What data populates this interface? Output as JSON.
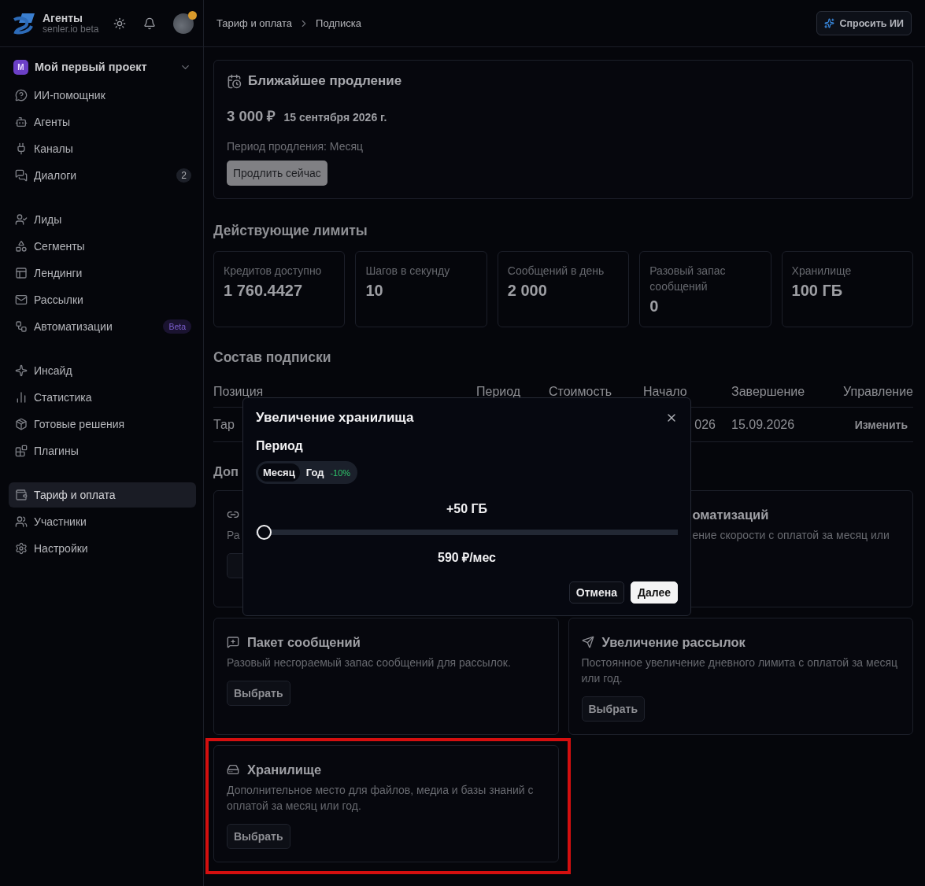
{
  "sidebar": {
    "brand": {
      "name": "Агенты",
      "subtitle": "senler.io beta"
    },
    "project": {
      "initial": "М",
      "name": "Мой первый проект"
    },
    "groups": [
      {
        "items": [
          {
            "label": "ИИ-помощник",
            "selected": false
          },
          {
            "label": "Агенты",
            "selected": false
          },
          {
            "label": "Каналы",
            "selected": false
          },
          {
            "label": "Диалоги",
            "selected": false,
            "badge": {
              "text": "2",
              "kind": "count"
            }
          }
        ]
      },
      {
        "items": [
          {
            "label": "Лиды",
            "selected": false
          },
          {
            "label": "Сегменты",
            "selected": false
          },
          {
            "label": "Лендинги",
            "selected": false
          },
          {
            "label": "Рассылки",
            "selected": false
          },
          {
            "label": "Автоматизации",
            "selected": false,
            "badge": {
              "text": "Beta",
              "kind": "beta"
            }
          }
        ]
      },
      {
        "items": [
          {
            "label": "Инсайд",
            "selected": false
          },
          {
            "label": "Статистика",
            "selected": false
          },
          {
            "label": "Готовые решения",
            "selected": false
          },
          {
            "label": "Плагины",
            "selected": false
          }
        ]
      },
      {
        "items": [
          {
            "label": "Тариф и оплата",
            "selected": true
          },
          {
            "label": "Участники",
            "selected": false
          },
          {
            "label": "Настройки",
            "selected": false
          }
        ]
      }
    ]
  },
  "breadcrumb": [
    "Тариф и оплата",
    "Подписка"
  ],
  "ask_button": "Спросить ИИ",
  "renewal": {
    "title": "Ближайшее продление",
    "amount": "3 000 ₽",
    "date": "15 сентября 2026 г.",
    "period": "Период продления: Месяц",
    "button": "Продлить сейчас"
  },
  "limits": {
    "title": "Действующие лимиты",
    "items": [
      {
        "label": "Кредитов доступно",
        "value": "1 760.4427"
      },
      {
        "label": "Шагов в секунду",
        "value": "10"
      },
      {
        "label": "Сообщений в день",
        "value": "2 000"
      },
      {
        "label": "Разовый запас сообщений",
        "value": "0"
      },
      {
        "label": "Хранилище",
        "value": "100 ГБ"
      }
    ]
  },
  "subscription": {
    "title": "Состав подписки",
    "columns": [
      "Позиция",
      "Период",
      "Стоимость",
      "Начало",
      "Завершение",
      "Управление"
    ],
    "row": {
      "position": "Тар",
      "start": "026",
      "end": "15.09.2026",
      "action": "Изменить"
    }
  },
  "addons": {
    "title": "Доп",
    "cards": [
      {
        "kind": "covered",
        "description": "Ра",
        "highlighted": false
      },
      {
        "kind": "covered_right",
        "title": "оматизаций",
        "description": "ение скорости с оплатой за месяц или",
        "highlighted": false
      },
      {
        "kind": "full",
        "title": "Пакет сообщений",
        "description": "Разовый несгораемый запас сообщений для рассылок.",
        "button": "Выбрать",
        "highlighted": false
      },
      {
        "kind": "full",
        "title": "Увеличение рассылок",
        "description": "Постоянное увеличение дневного лимита с оплатой за месяц или год.",
        "button": "Выбрать",
        "highlighted": false
      },
      {
        "kind": "full",
        "title": "Хранилище",
        "description": "Дополнительное место для файлов, медиа и базы знаний с оплатой за месяц или год.",
        "button": "Выбрать",
        "highlighted": true
      }
    ]
  },
  "modal": {
    "title": "Увеличение хранилища",
    "period_label": "Период",
    "periods": [
      {
        "label": "Месяц",
        "selected": true
      },
      {
        "label": "Год",
        "selected": false,
        "discount": "-10%"
      }
    ],
    "amount": "+50 ГБ",
    "level": 0,
    "price": "590 ₽/мес",
    "buttons": [
      {
        "label": "Отмена",
        "kind": "secondary"
      },
      {
        "label": "Далее",
        "kind": "primary"
      }
    ]
  }
}
